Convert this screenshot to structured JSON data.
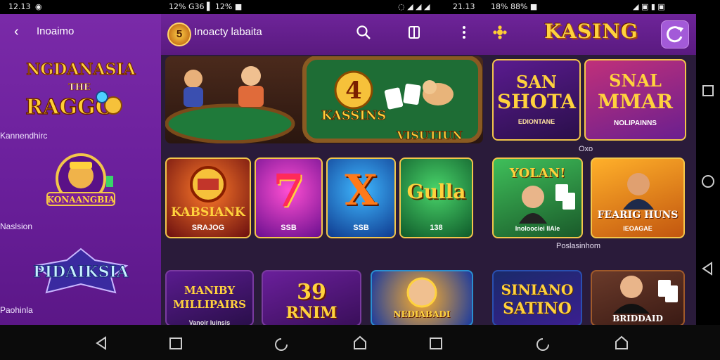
{
  "status_bar": {
    "time": "12.13",
    "left_text": "12% G36 ▌ 12% ■",
    "center_text": "18% 88% ■",
    "right_text": "21.13"
  },
  "app": {
    "title": "Inoacty labaita",
    "brand": "KASING"
  },
  "sidebar": {
    "title": "Inoaimo",
    "items": [
      {
        "art_line1": "NGDANASIA",
        "art_line2": "THE",
        "art_line3": "RAGGO",
        "label": "Kannendhirc"
      },
      {
        "art_line1": "KONAANGBIA",
        "label": "Naslsion"
      },
      {
        "art_line1": "PIDAIKSIA",
        "label": "Paohinla"
      }
    ]
  },
  "hero": {
    "center_number": "4",
    "center_title": "KASSINS",
    "center_sub": "VISUTIUN"
  },
  "promos": [
    {
      "line1": "SAN",
      "line2": "SHOTA",
      "sub": "EDIONTANE"
    },
    {
      "line1": "SNAL",
      "line2": "MMAR",
      "sub": "NOLIPAINNS"
    }
  ],
  "promo_caption": "Oxo",
  "games_row1": [
    {
      "title": "KABSIANK",
      "sub": "SRAJOG"
    },
    {
      "title": "7",
      "sub": "SSB"
    },
    {
      "title": "X",
      "sub": "SSB"
    },
    {
      "title": "Gulla",
      "sub": "138"
    }
  ],
  "featured_row1": [
    {
      "title": "YOLAN!",
      "sub": "Inoloociei IlAIe"
    },
    {
      "title": "FEARIG HUNS",
      "sub": "IEOAGAE"
    }
  ],
  "featured_caption": "Poslasinhom",
  "games_row2": [
    {
      "title1": "MANIBY",
      "title2": "MILLIPAIRS",
      "sub": "Vanoir Iuinsis"
    },
    {
      "title1": "39",
      "title2": "RNIM"
    },
    {
      "title1": "NEDIABADI"
    },
    {
      "title1": "SINIANO",
      "title2": "SATINO"
    },
    {
      "title1": "BRIDDAID"
    }
  ],
  "colors": {
    "sidebar": "#6a1f9b",
    "accent_gold": "#f3c64a",
    "background": "#2a1b3a"
  }
}
